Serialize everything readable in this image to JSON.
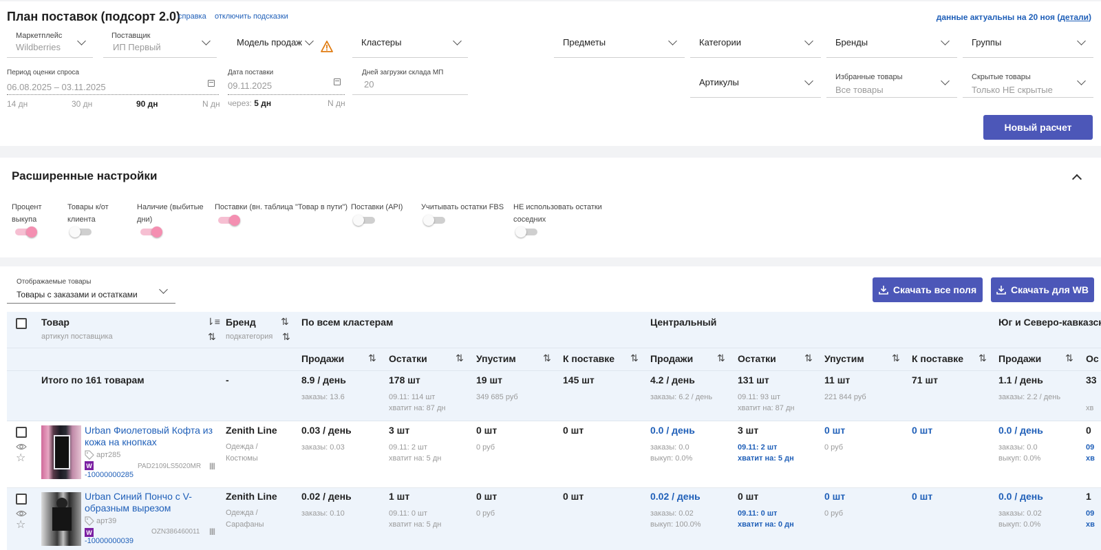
{
  "header": {
    "title": "План поставок (подсорт 2.0)",
    "help_link": "справка",
    "hints_link": "отключить подсказки",
    "actuality_prefix": "данные актуальны на 20 ноя (",
    "actuality_link": "детали",
    "actuality_suffix": ")"
  },
  "filters": {
    "marketplace": {
      "label": "Маркетплейс",
      "value": "Wildberries"
    },
    "supplier": {
      "label": "Поставщик",
      "value": "ИП Первый"
    },
    "sales_model": {
      "label": "Модель продаж"
    },
    "clusters": {
      "label": "Кластеры"
    },
    "subjects": {
      "label": "Предметы"
    },
    "categories": {
      "label": "Категории"
    },
    "brands": {
      "label": "Бренды"
    },
    "groups": {
      "label": "Группы"
    },
    "articles": {
      "label": "Артикулы"
    },
    "favorites": {
      "label": "Избранные товары",
      "value": "Все товары"
    },
    "hidden": {
      "label": "Скрытые товары",
      "value": "Только НЕ скрытые"
    },
    "period": {
      "label": "Период оценки спроса",
      "value": "06.08.2025 – 03.11.2025",
      "opt1": "14 дн",
      "opt2": "30 дн",
      "opt3": "90 дн",
      "opt4": "N дн"
    },
    "delivery_date": {
      "label": "Дата поставки",
      "value": "09.11.2025",
      "through_label": "через:",
      "through_value": "5 дн",
      "n_opt": "N дн"
    },
    "load_days": {
      "label": "Дней загрузки склада МП",
      "value": "20"
    },
    "new_calc_button": "Новый расчет"
  },
  "advanced": {
    "title": "Расширенные настройки",
    "toggles": [
      {
        "label1": "Процент",
        "label2": "выкупа",
        "on": true
      },
      {
        "label1": "Товары к/от",
        "label2": "клиента",
        "on": false
      },
      {
        "label1": "Наличие (выбитые",
        "label2": "дни)",
        "on": true
      },
      {
        "label1": "Поставки (вн. таблица \"Товар в пути\")",
        "label2": "",
        "on": true
      },
      {
        "label1": "Поставки (API)",
        "label2": "",
        "on": false
      },
      {
        "label1": "Учитывать остатки FBS",
        "label2": "",
        "on": false
      },
      {
        "label1": "НЕ использовать остатки",
        "label2": "соседних",
        "on": false
      }
    ]
  },
  "table_controls": {
    "display_label": "Отображаемые товары",
    "display_value": "Товары с заказами и остатками",
    "download_all": "Скачать все поля",
    "download_wb": "Скачать для WB"
  },
  "table": {
    "col_product": "Товар",
    "col_product_sub": "артикул поставщика",
    "col_brand": "Бренд",
    "col_brand_sub": "подкатегория",
    "group_all": "По всем кластерам",
    "group_central": "Центральный",
    "group_south": "Юг и Северо-кавказский",
    "sub_sales": "Продажи",
    "sub_stock": "Остатки",
    "sub_missed": "Упустим",
    "sub_supply": "К поставке",
    "sub_stock_cut": "Ос",
    "totals": {
      "label": "Итого по 161 товарам",
      "brand": "-",
      "all_sales": "8.9 / день",
      "all_sales_sub": "заказы: 13.6",
      "all_stock": "178 шт",
      "all_stock_sub1": "09.11: 114 шт",
      "all_stock_sub2": "хватит на: 87 дн",
      "all_missed": "19 шт",
      "all_missed_sub": "349 685 руб",
      "all_supply": "145 шт",
      "c_sales": "4.2 / день",
      "c_sales_sub": "заказы: 6.2 / день",
      "c_stock": "131 шт",
      "c_stock_sub1": "09.11: 93 шт",
      "c_stock_sub2": "хватит на: 87 дн",
      "c_missed": "11 шт",
      "c_missed_sub": "221 844 руб",
      "c_supply": "71 шт",
      "s_sales": "1.1 / день",
      "s_sales_sub": "заказы: 2.2 / день",
      "s_stock_cut": "33",
      "s_stock_cut_sub": "хв"
    },
    "rows": [
      {
        "name1": "Urban Фиолетовый Кофта из",
        "name2": "кожа на кнопках",
        "art": "арт285",
        "wb": "W",
        "sku": "PAD2109LS5020MR",
        "id": "-10000000285",
        "brand": "Zenith Line",
        "cat1": "Одежда /",
        "cat2": "Костюмы",
        "all_sales": "0.03 / день",
        "all_sales_sub": "заказы: 0.03",
        "all_stock": "3 шт",
        "all_stock_sub1": "09.11: 2 шт",
        "all_stock_sub2": "хватит на: 5 дн",
        "all_missed": "0 шт",
        "all_missed_sub": "0 руб",
        "all_supply": "0 шт",
        "c_sales": "0.0 / день",
        "c_sales_sub1": "заказы: 0.0",
        "c_sales_sub2": "выкуп: 0.0%",
        "c_stock": "3 шт",
        "c_stock_sub1": "09.11: 2 шт",
        "c_stock_sub2": "хватит на: 5 дн",
        "c_missed": "0 шт",
        "c_missed_sub": "0 руб",
        "c_supply": "0 шт",
        "s_sales": "0.0 / день",
        "s_sales_sub1": "заказы: 0.0",
        "s_sales_sub2": "выкуп: 0.0%",
        "s_cut": "0",
        "s_cut_sub1": "09",
        "s_cut_sub2": "хв"
      },
      {
        "name1": "Urban Синий Пончо с V-",
        "name2": "образным вырезом",
        "art": "арт39",
        "wb": "W",
        "sku": "OZN386460011",
        "id": "-10000000039",
        "brand": "Zenith Line",
        "cat1": "Одежда /",
        "cat2": "Сарафаны",
        "all_sales": "0.02 / день",
        "all_sales_sub": "заказы: 0.10",
        "all_stock": "1 шт",
        "all_stock_sub1": "09.11: 0 шт",
        "all_stock_sub2": "хватит на: 5 дн",
        "all_missed": "0 шт",
        "all_missed_sub": "0 руб",
        "all_supply": "0 шт",
        "c_sales": "0.02 / день",
        "c_sales_sub1": "заказы: 0.02",
        "c_sales_sub2": "выкуп: 100.0%",
        "c_stock": "0 шт",
        "c_stock_sub1": "09.11: 0 шт",
        "c_stock_sub2": "хватит на: 0 дн",
        "c_missed": "0 шт",
        "c_missed_sub": "0 руб",
        "c_supply": "0 шт",
        "s_sales": "0.0 / день",
        "s_sales_sub1": "заказы: 0.02",
        "s_sales_sub2": "выкуп: 0.0%",
        "s_cut": "1",
        "s_cut_sub1": "09",
        "s_cut_sub2": "хв"
      }
    ]
  },
  "colors": {
    "accent": "#4c57b8",
    "link": "#1f5fb8",
    "toggle_on": "#f48fb1",
    "header_bg": "#eef4fb"
  }
}
